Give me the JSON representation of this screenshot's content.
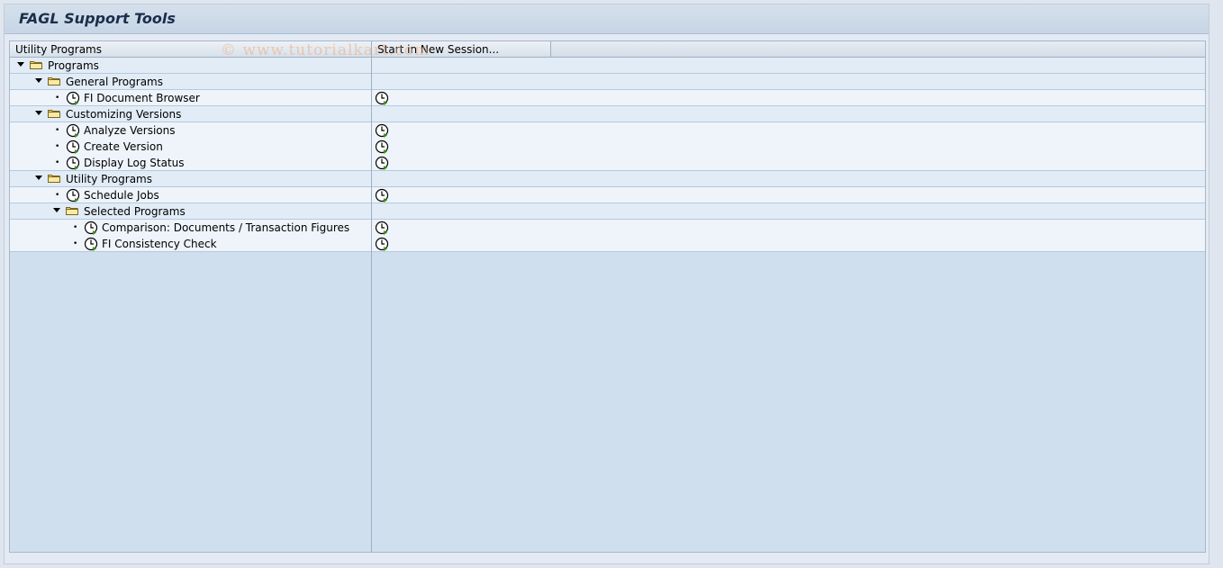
{
  "window": {
    "title": "FAGL Support Tools",
    "watermark": "© www.tutorialkart.com"
  },
  "columns": {
    "col1": "Utility Programs",
    "col2": "Start in New Session..."
  },
  "tree": {
    "programs": "Programs",
    "general_programs": "General Programs",
    "fi_document_browser": "FI Document Browser",
    "customizing_versions": "Customizing Versions",
    "analyze_versions": "Analyze Versions",
    "create_version": "Create Version",
    "display_log_status": "Display Log Status",
    "utility_programs": "Utility Programs",
    "schedule_jobs": "Schedule Jobs",
    "selected_programs": "Selected Programs",
    "comparison": "Comparison: Documents / Transaction Figures",
    "fi_consistency_check": "FI Consistency Check"
  },
  "icons": {
    "folder": "folder-open-icon",
    "program": "clock-program-icon",
    "execute": "execute-in-new-session-icon"
  },
  "colors": {
    "accent_green": "#3f8f1f",
    "folder_yellow": "#f3d66a"
  }
}
